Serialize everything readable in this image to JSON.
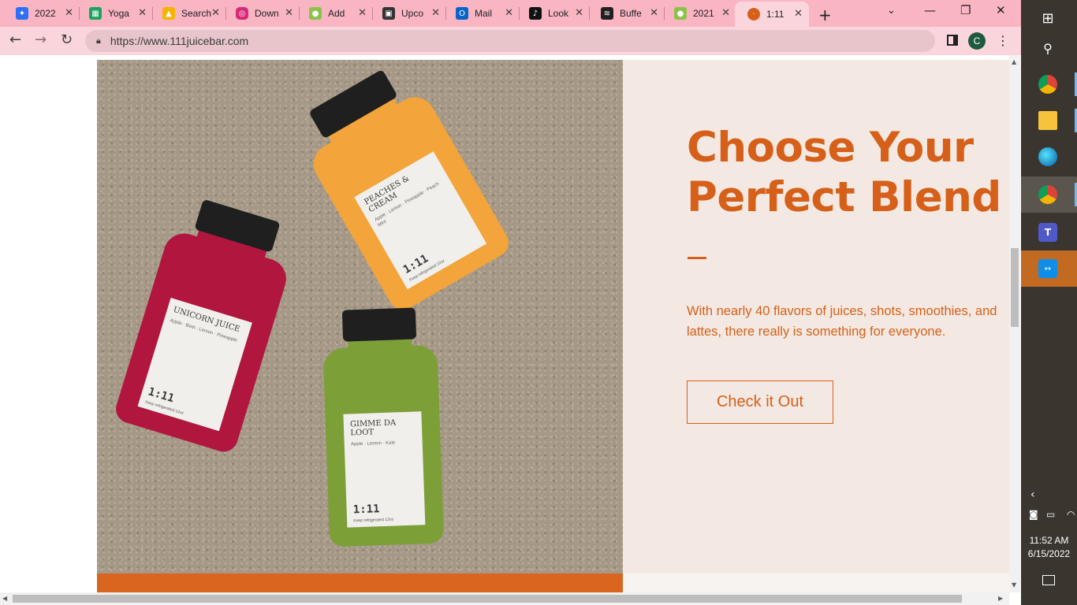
{
  "tabs": [
    {
      "label": "2022",
      "icon": "dropbox-icon",
      "color": "#2f6ef6"
    },
    {
      "label": "Yoga",
      "icon": "google-sheets-icon",
      "color": "#1aa260"
    },
    {
      "label": "Search",
      "icon": "google-drive-icon",
      "color": "#f4b400"
    },
    {
      "label": "Down",
      "icon": "instagram-icon",
      "color": "#d62976"
    },
    {
      "label": "Add",
      "icon": "android-icon",
      "color": "#8bc34a"
    },
    {
      "label": "Upco",
      "icon": "upcoming-icon",
      "color": "#333333"
    },
    {
      "label": "Mail",
      "icon": "outlook-icon",
      "color": "#0a64c6"
    },
    {
      "label": "Look",
      "icon": "tiktok-icon",
      "color": "#111111"
    },
    {
      "label": "Buffe",
      "icon": "buffer-icon",
      "color": "#231f20"
    },
    {
      "label": "2021",
      "icon": "android-icon",
      "color": "#8bc34a"
    },
    {
      "label": "1:11",
      "icon": "111-logo-icon",
      "color": "#d6601a"
    }
  ],
  "browser": {
    "url": "https://www.111juicebar.com",
    "profile_initial": "C"
  },
  "hero": {
    "headline": "Choose Your Perfect Blend",
    "description": "With nearly 40 flavors of juices, shots, smoothies, and lattes, there really is something for everyone.",
    "cta_label": "Check it Out"
  },
  "bottles": [
    {
      "name": "PEACHES & CREAM",
      "ingredients": "Apple · Lemon · Pineapple · Peach Mint",
      "logo": "1:11",
      "footer": "Keep refrigerated 12oz",
      "color": "#f3a43a"
    },
    {
      "name": "UNICORN JUICE",
      "ingredients": "Apple · Beet · Lemon · Pineapple",
      "logo": "1:11",
      "footer": "Keep refrigerated 12oz",
      "color": "#b0163e"
    },
    {
      "name": "GIMME DA LOOT",
      "ingredients": "Apple · Lemon · Kale",
      "logo": "1:11",
      "footer": "Keep refrigerated 12oz",
      "color": "#7c9f38"
    }
  ],
  "colors": {
    "accent": "#d6601a",
    "panel_bg": "#f3e9e2",
    "tabbar_bg": "#f9b5c2",
    "taskbar_bg": "#3a362f"
  },
  "taskbar": {
    "time": "11:52 AM",
    "date": "6/15/2022",
    "icons": [
      "windows-start-icon",
      "search-icon",
      "chrome-icon",
      "file-explorer-icon",
      "edge-icon",
      "chrome-icon",
      "teams-icon",
      "teamviewer-icon"
    ]
  }
}
